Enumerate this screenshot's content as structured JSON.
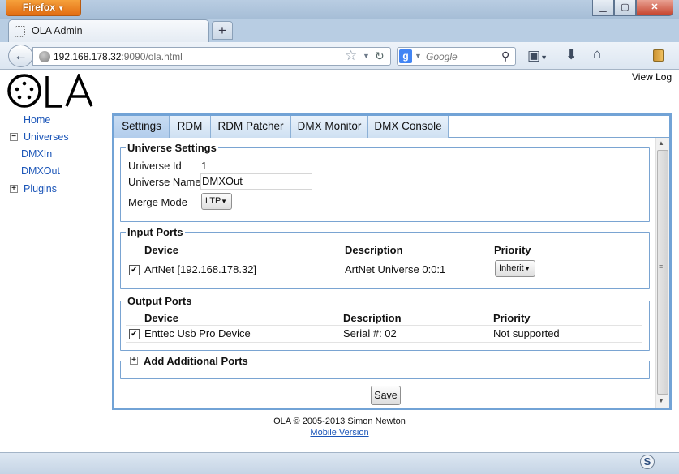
{
  "browser": {
    "app_button": "Firefox",
    "tab_title": "OLA Admin",
    "url_host": "192.168.178.32",
    "url_rest": ":9090/ola.html",
    "search_placeholder": "Google",
    "search_engine_icon": "g-logo-icon"
  },
  "header": {
    "view_log": "View Log"
  },
  "sidebar": {
    "home": "Home",
    "universes": "Universes",
    "universe_items": [
      "DMXIn",
      "DMXOut"
    ],
    "plugins": "Plugins"
  },
  "tabs": [
    "Settings",
    "RDM",
    "RDM Patcher",
    "DMX Monitor",
    "DMX Console"
  ],
  "universe_settings": {
    "legend": "Universe Settings",
    "id_label": "Universe Id",
    "id_value": "1",
    "name_label": "Universe Name",
    "name_value": "DMXOut",
    "merge_label": "Merge Mode",
    "merge_value": "LTP"
  },
  "input_ports": {
    "legend": "Input Ports",
    "headers": [
      "Device",
      "Description",
      "Priority"
    ],
    "rows": [
      {
        "device": "ArtNet [192.168.178.32]",
        "description": "ArtNet Universe 0:0:1",
        "priority": "Inherit",
        "checked": true
      }
    ]
  },
  "output_ports": {
    "legend": "Output Ports",
    "headers": [
      "Device",
      "Description",
      "Priority"
    ],
    "rows": [
      {
        "device": "Enttec Usb Pro Device",
        "description": "Serial #: 02",
        "priority": "Not supported",
        "checked": true
      }
    ]
  },
  "additional": {
    "legend": "Add Additional Ports"
  },
  "save_label": "Save",
  "footer": {
    "copyright": "OLA © 2005-2013 Simon Newton",
    "mobile_link": "Mobile Version"
  },
  "colors": {
    "panel_border": "#72a3d6",
    "link": "#1c56b8",
    "firefox_orange": "#e26c12"
  }
}
